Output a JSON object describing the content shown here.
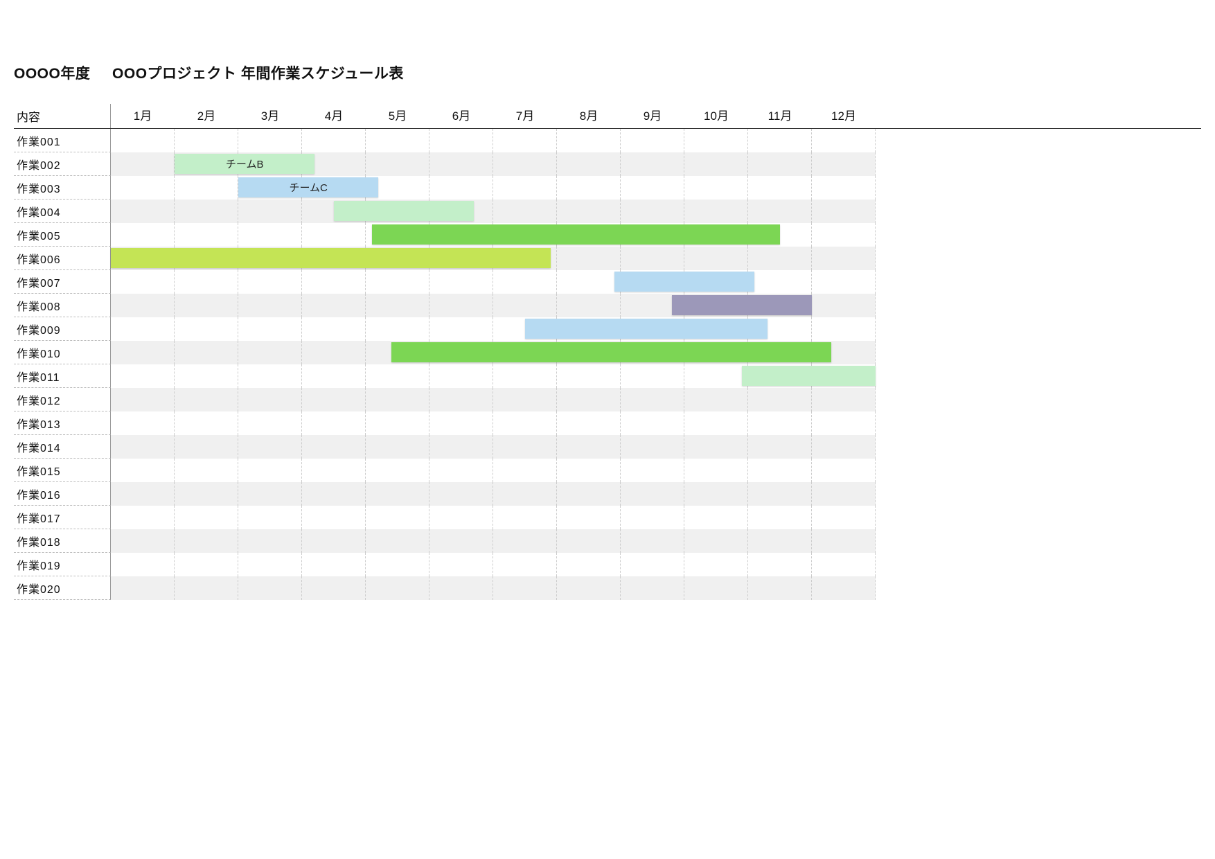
{
  "title_left": "OOOO年度",
  "title_right": "OOOプロジェクト 年間作業スケジュール表",
  "header_label": "内容",
  "months": [
    "1月",
    "2月",
    "3月",
    "4月",
    "5月",
    "6月",
    "7月",
    "8月",
    "9月",
    "10月",
    "11月",
    "12月"
  ],
  "rows": [
    {
      "label": "作業001"
    },
    {
      "label": "作業002"
    },
    {
      "label": "作業003"
    },
    {
      "label": "作業004"
    },
    {
      "label": "作業005"
    },
    {
      "label": "作業006"
    },
    {
      "label": "作業007"
    },
    {
      "label": "作業008"
    },
    {
      "label": "作業009"
    },
    {
      "label": "作業010"
    },
    {
      "label": "作業011"
    },
    {
      "label": "作業012"
    },
    {
      "label": "作業013"
    },
    {
      "label": "作業014"
    },
    {
      "label": "作業015"
    },
    {
      "label": "作業016"
    },
    {
      "label": "作業017"
    },
    {
      "label": "作業018"
    },
    {
      "label": "作業019"
    },
    {
      "label": "作業020"
    }
  ],
  "chart_data": {
    "type": "bar",
    "title": "OOOプロジェクト 年間作業スケジュール表",
    "xlabel": "月",
    "ylabel": "内容",
    "categories": [
      "1月",
      "2月",
      "3月",
      "4月",
      "5月",
      "6月",
      "7月",
      "8月",
      "9月",
      "10月",
      "11月",
      "12月"
    ],
    "series": [
      {
        "row": "作業002",
        "start": 2.0,
        "end": 4.2,
        "label": "チームB",
        "color": "#C3EFC9"
      },
      {
        "row": "作業003",
        "start": 3.0,
        "end": 5.2,
        "label": "チームC",
        "color": "#B6DAF2"
      },
      {
        "row": "作業004",
        "start": 4.5,
        "end": 6.7,
        "label": "",
        "color": "#C3EFC9"
      },
      {
        "row": "作業005",
        "start": 5.1,
        "end": 11.5,
        "label": "",
        "color": "#7CD654"
      },
      {
        "row": "作業006",
        "start": 1.0,
        "end": 7.9,
        "label": "",
        "color": "#C4E455"
      },
      {
        "row": "作業007",
        "start": 8.9,
        "end": 11.1,
        "label": "",
        "color": "#B6DAF2"
      },
      {
        "row": "作業008",
        "start": 9.8,
        "end": 12.0,
        "label": "",
        "color": "#9C98B9"
      },
      {
        "row": "作業009",
        "start": 7.5,
        "end": 11.3,
        "label": "",
        "color": "#B6DAF2"
      },
      {
        "row": "作業010",
        "start": 5.4,
        "end": 12.3,
        "label": "",
        "color": "#7CD654"
      },
      {
        "row": "作業011",
        "start": 10.9,
        "end": 13.0,
        "label": "",
        "color": "#C3EFC9"
      }
    ]
  },
  "colors": {
    "lightgreen": "#C3EFC9",
    "lightblue": "#B6DAF2",
    "green": "#7CD654",
    "yellowgreen": "#C4E455",
    "mauve": "#9C98B9"
  }
}
